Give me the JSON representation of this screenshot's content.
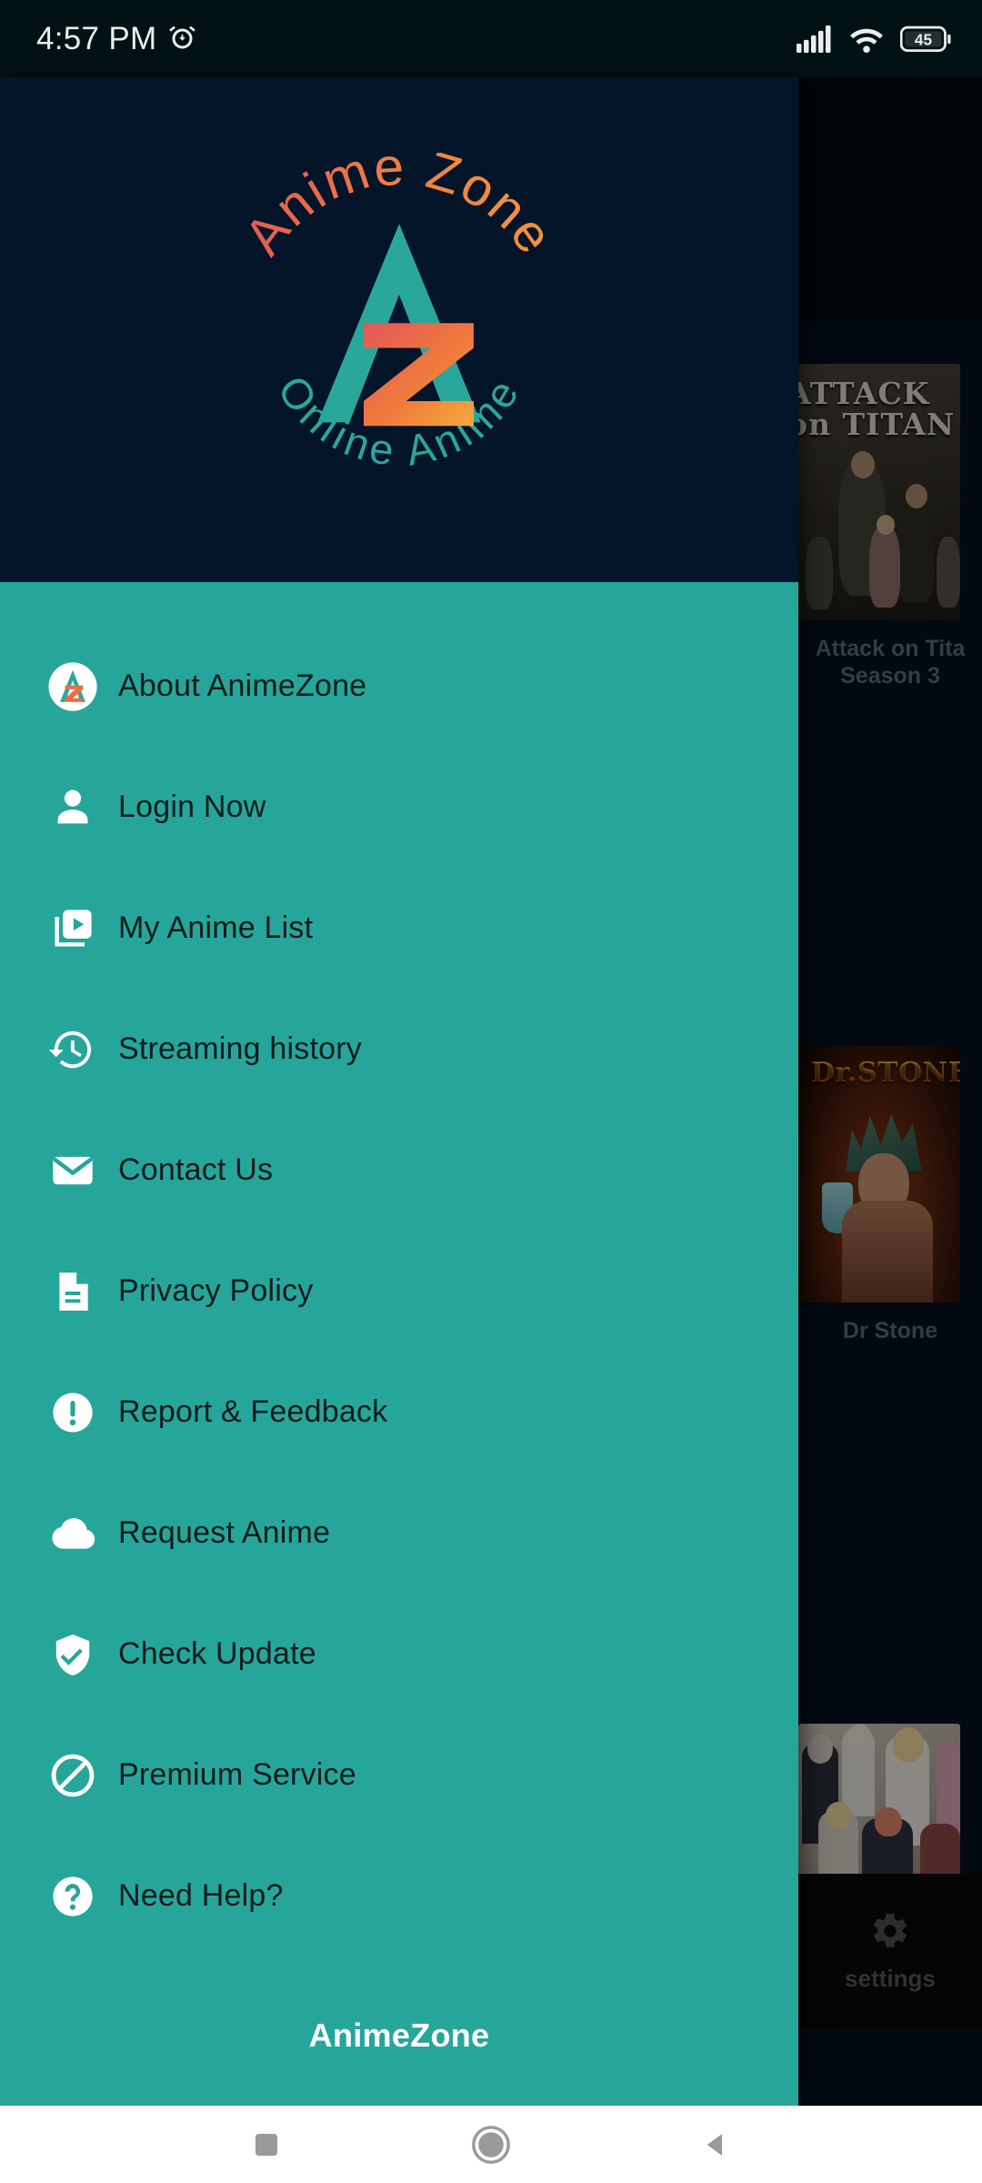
{
  "status_bar": {
    "time": "4:57 PM",
    "alarm_icon": "alarm-clock-icon",
    "signal_icon": "cellular-signal-icon",
    "wifi_icon": "wifi-icon",
    "battery_icon": "battery-icon",
    "battery_level": "45"
  },
  "drawer": {
    "logo": {
      "arc_top_text": "Anime Zone",
      "arc_bottom_text": "Online Anime",
      "monogram_a": "A",
      "monogram_z": "Z",
      "teal": "#26a69a",
      "orange": "#f4873a",
      "red": "#e4565a"
    },
    "background": "#26a69a",
    "header_background": "#041529",
    "items": [
      {
        "label": "About AnimeZone",
        "icon": "animezone-logo-icon"
      },
      {
        "label": "Login Now",
        "icon": "person-icon"
      },
      {
        "label": "My Anime List",
        "icon": "video-library-icon"
      },
      {
        "label": "Streaming history",
        "icon": "history-icon"
      },
      {
        "label": "Contact Us",
        "icon": "envelope-icon"
      },
      {
        "label": "Privacy Policy",
        "icon": "document-icon"
      },
      {
        "label": "Report & Feedback",
        "icon": "exclamation-circle-icon"
      },
      {
        "label": "Request Anime",
        "icon": "cloud-icon"
      },
      {
        "label": "Check Update",
        "icon": "shield-check-icon"
      },
      {
        "label": "Premium Service",
        "icon": "block-circle-icon"
      },
      {
        "label": "Need Help?",
        "icon": "question-circle-icon"
      }
    ],
    "footer_brand": "AnimeZone"
  },
  "background_app": {
    "cards": [
      {
        "title": "Attack on Tita",
        "subtitle": "Season 3",
        "poster": "attack-on-titan-poster",
        "poster_title_line1": "ATTACK",
        "poster_title_line2": "on TITAN"
      },
      {
        "title": "Dr Stone",
        "subtitle": "",
        "poster": "dr-stone-poster",
        "poster_title": "Dr.STONE"
      },
      {
        "title": "",
        "subtitle": "",
        "poster": "food-wars-poster",
        "poster_title": ""
      }
    ],
    "settings": {
      "label": "settings",
      "icon": "gear-icon"
    }
  },
  "nav_bar": {
    "recents": "recents-square-icon",
    "home": "home-circle-icon",
    "back": "back-triangle-icon"
  }
}
